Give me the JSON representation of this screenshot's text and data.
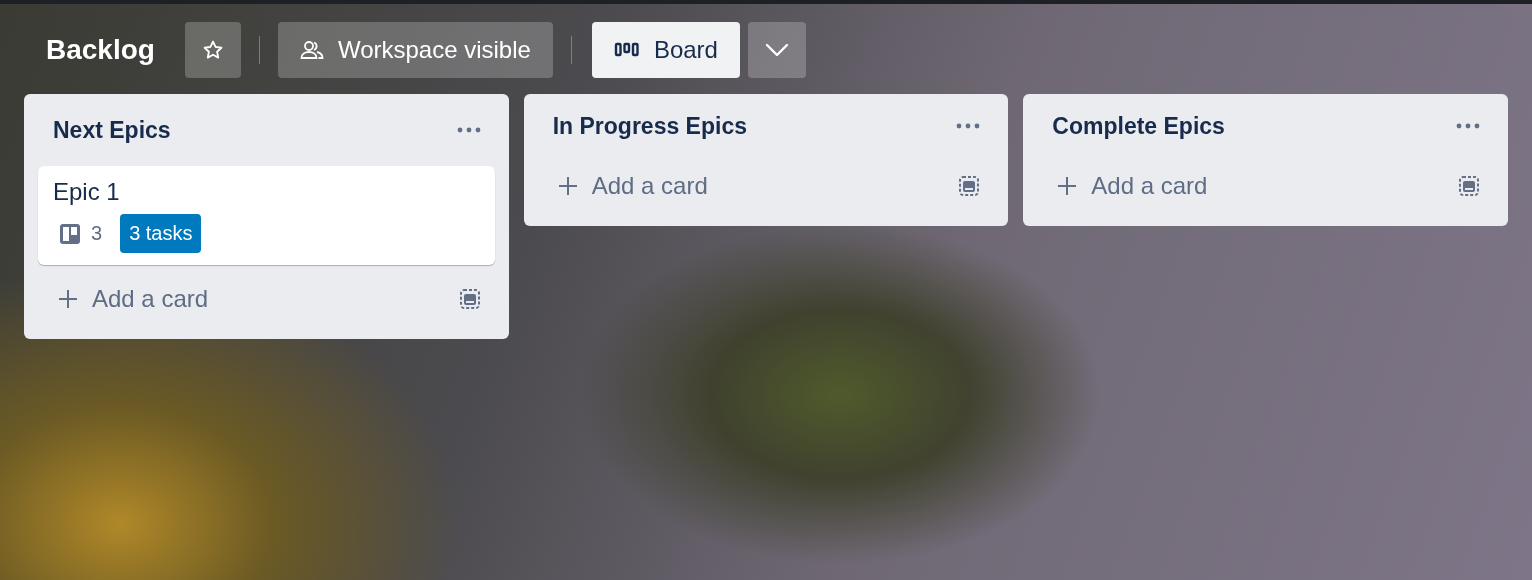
{
  "board": {
    "title": "Backlog",
    "starred": false,
    "visibility": "Workspace visible",
    "view": "Board"
  },
  "lists": [
    {
      "title": "Next Epics",
      "cards": [
        {
          "title": "Epic 1",
          "checklist_count": "3",
          "badge": "3 tasks"
        }
      ],
      "add_label": "Add a card"
    },
    {
      "title": "In Progress Epics",
      "add_label": "Add a card"
    },
    {
      "title": "Complete Epics",
      "add_label": "Add a card"
    }
  ]
}
